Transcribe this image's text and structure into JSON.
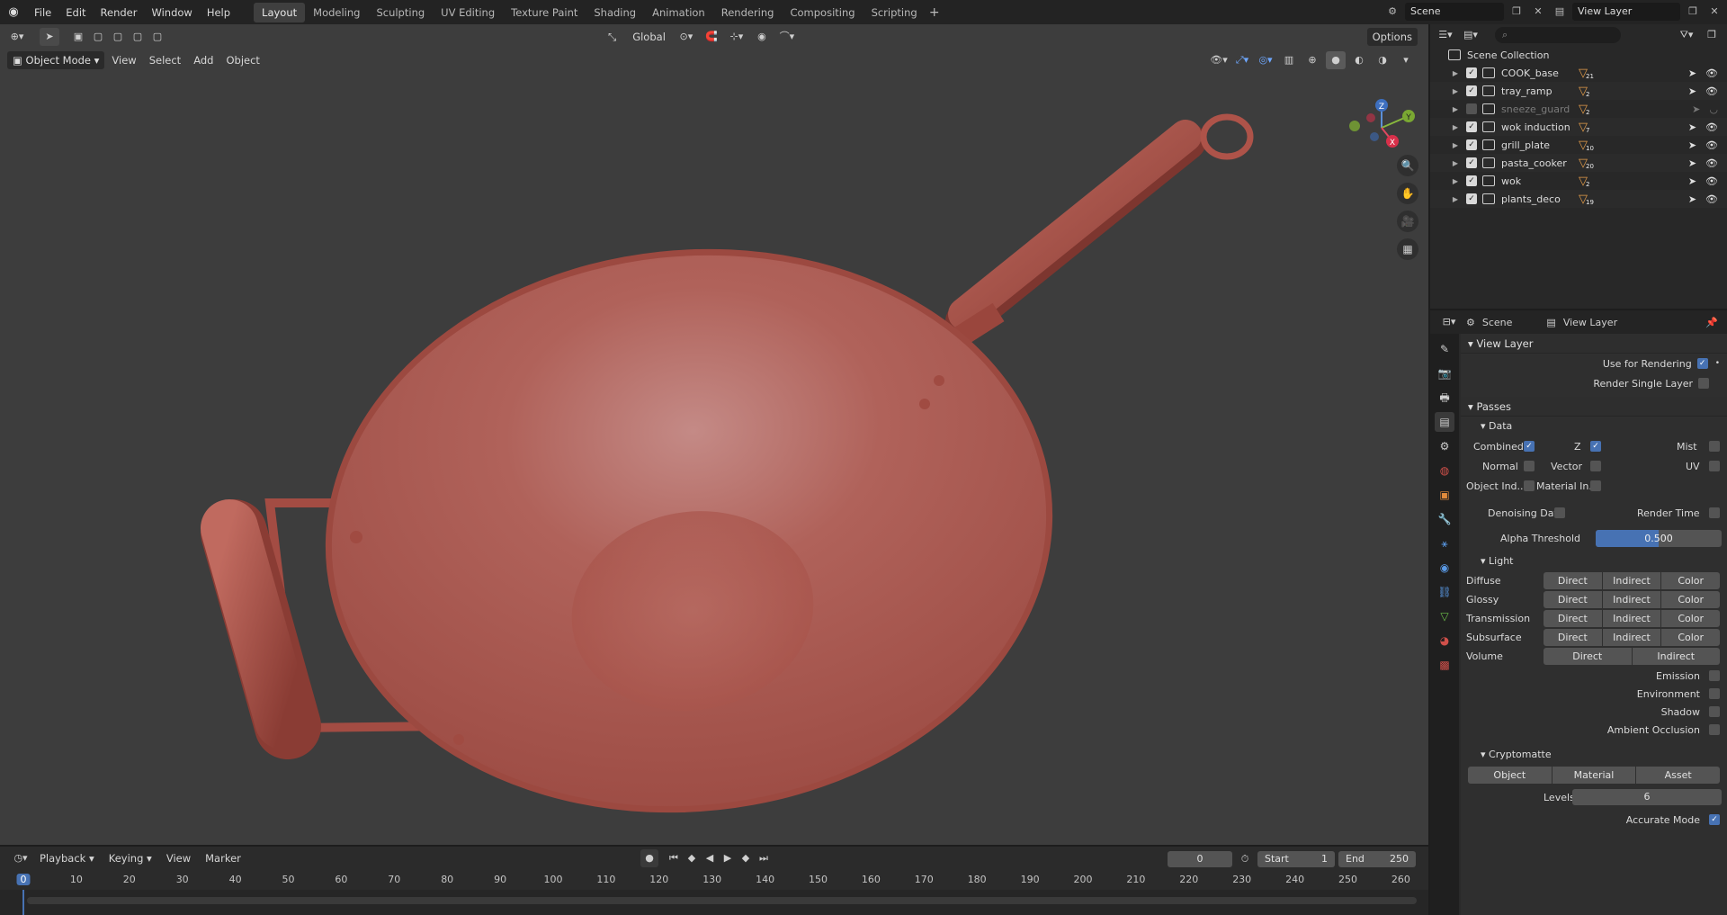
{
  "menubar": {
    "items": [
      "File",
      "Edit",
      "Render",
      "Window",
      "Help"
    ],
    "workspaces": [
      "Layout",
      "Modeling",
      "Sculpting",
      "UV Editing",
      "Texture Paint",
      "Shading",
      "Animation",
      "Rendering",
      "Compositing",
      "Scripting"
    ],
    "active_workspace": "Layout",
    "scene": "Scene",
    "view_layer": "View Layer"
  },
  "viewport": {
    "mode": "Object Mode",
    "menus": [
      "View",
      "Select",
      "Add",
      "Object"
    ],
    "orientation": "Global",
    "options": "Options",
    "gizmo_axes": [
      "Z",
      "Y",
      "X"
    ],
    "object_color": "#b5574c"
  },
  "outliner": {
    "root": "Scene Collection",
    "collections": [
      {
        "name": "COOK_base",
        "count": "21",
        "visible": true
      },
      {
        "name": "tray_ramp",
        "count": "2",
        "visible": true
      },
      {
        "name": "sneeze_guard",
        "count": "2",
        "visible": false
      },
      {
        "name": "wok induction",
        "count": "7",
        "visible": true
      },
      {
        "name": "grill_plate",
        "count": "10",
        "visible": true
      },
      {
        "name": "pasta_cooker",
        "count": "20",
        "visible": true
      },
      {
        "name": "wok",
        "count": "2",
        "visible": true
      },
      {
        "name": "plants_deco",
        "count": "19",
        "visible": true
      }
    ]
  },
  "properties": {
    "header_scene": "Scene",
    "header_view_layer": "View Layer",
    "view_layer_section": "View Layer",
    "use_for_rendering": "Use for Rendering",
    "render_single_layer": "Render Single Layer",
    "passes_section": "Passes",
    "data_sub": "Data",
    "data_items": {
      "combined": "Combined",
      "z": "Z",
      "mist": "Mist",
      "normal": "Normal",
      "vector": "Vector",
      "uv": "UV",
      "object_ind": "Object Ind..",
      "material_in": "Material In..",
      "denoising_data": "Denoising Data",
      "render_time": "Render Time"
    },
    "alpha_threshold_label": "Alpha Threshold",
    "alpha_threshold_value": "0.500",
    "alpha_threshold_fraction": 0.5,
    "light_sub": "Light",
    "light_rows": [
      {
        "label": "Diffuse",
        "buttons": [
          "Direct",
          "Indirect",
          "Color"
        ]
      },
      {
        "label": "Glossy",
        "buttons": [
          "Direct",
          "Indirect",
          "Color"
        ]
      },
      {
        "label": "Transmission",
        "buttons": [
          "Direct",
          "Indirect",
          "Color"
        ]
      },
      {
        "label": "Subsurface",
        "buttons": [
          "Direct",
          "Indirect",
          "Color"
        ]
      },
      {
        "label": "Volume",
        "buttons": [
          "Direct",
          "Indirect"
        ]
      }
    ],
    "emission": "Emission",
    "environment": "Environment",
    "shadow": "Shadow",
    "ambient_occlusion": "Ambient Occlusion",
    "cryptomatte_sub": "Cryptomatte",
    "crypto_buttons": [
      "Object",
      "Material",
      "Asset"
    ],
    "levels_label": "Levels",
    "levels_value": "6",
    "accurate_mode": "Accurate Mode"
  },
  "timeline": {
    "menus": [
      "Playback",
      "Keying",
      "View",
      "Marker"
    ],
    "current_frame": "0",
    "start_label": "Start",
    "start_value": "1",
    "end_label": "End",
    "end_value": "250",
    "ruler": [
      "0",
      "10",
      "20",
      "30",
      "40",
      "50",
      "60",
      "70",
      "80",
      "90",
      "100",
      "110",
      "120",
      "130",
      "140",
      "150",
      "160",
      "170",
      "180",
      "190",
      "200",
      "210",
      "220",
      "230",
      "240",
      "250",
      "260"
    ]
  }
}
